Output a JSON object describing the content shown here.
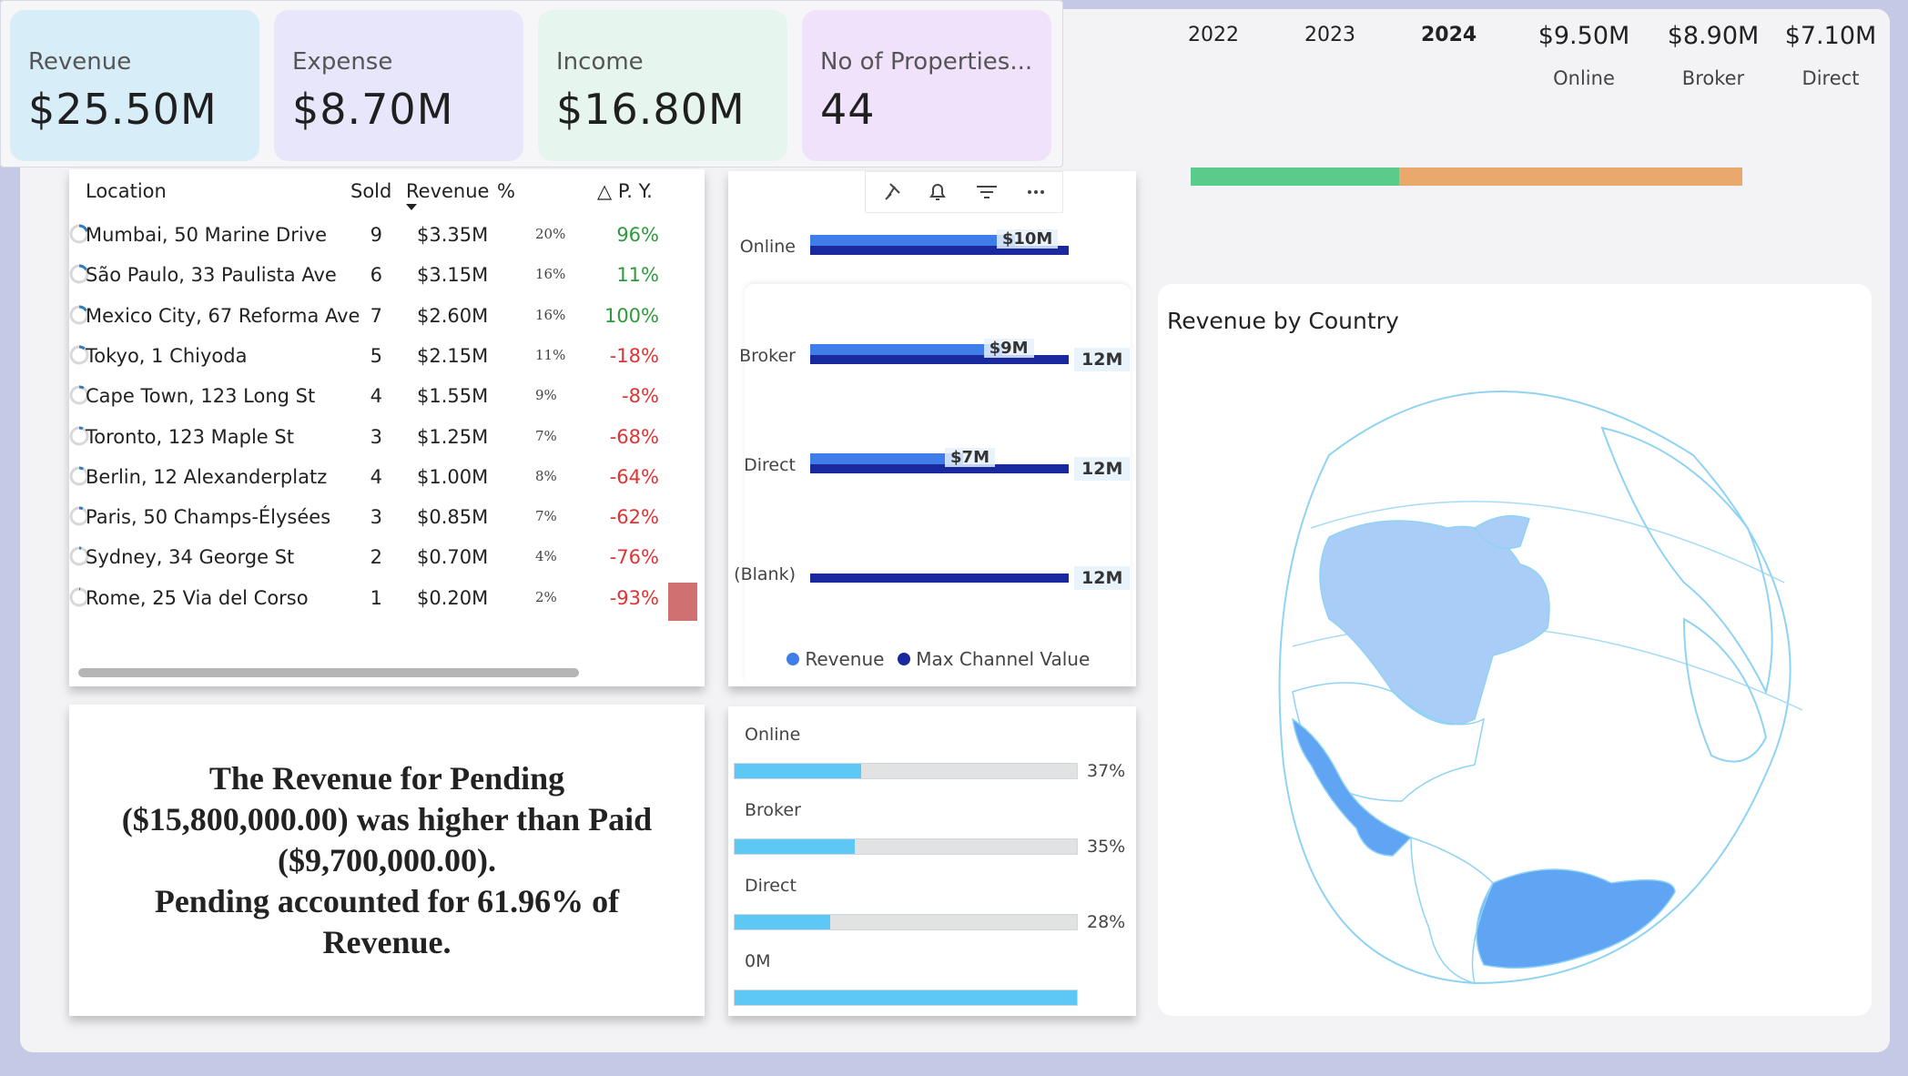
{
  "kpis": [
    {
      "label": "Revenue",
      "value": "$25.50M",
      "bg": "#d7edf7"
    },
    {
      "label": "Expense",
      "value": "$8.70M",
      "bg": "#e8e6fa"
    },
    {
      "label": "Income",
      "value": "$16.80M",
      "bg": "#e6f6ee"
    },
    {
      "label": "No of Properties...",
      "value": "44",
      "bg": "#f0e2fb"
    }
  ],
  "years": {
    "items": [
      "2022",
      "2023",
      "2024"
    ],
    "selected": "2024"
  },
  "channels": [
    {
      "value": "$9.50M",
      "label": "Online"
    },
    {
      "value": "$8.90M",
      "label": "Broker"
    },
    {
      "value": "$7.10M",
      "label": "Direct"
    }
  ],
  "progress_bar": {
    "segments": [
      {
        "share": 0.378,
        "color": "#5bcb8b"
      },
      {
        "share": 0.622,
        "color": "#e9a86c"
      }
    ]
  },
  "table": {
    "headers": {
      "location": "Location",
      "sold": "Sold",
      "revenue": "Revenue",
      "pct": "%",
      "py": "△ P. Y."
    },
    "rows": [
      {
        "location": "Mumbai, 50 Marine Drive",
        "sold": "9",
        "revenue": "$3.35M",
        "pct": "20%",
        "pct_value": 20,
        "py": "96%",
        "trend": "pos"
      },
      {
        "location": "São Paulo, 33 Paulista Ave",
        "sold": "6",
        "revenue": "$3.15M",
        "pct": "16%",
        "pct_value": 16,
        "py": "11%",
        "trend": "pos"
      },
      {
        "location": "Mexico City, 67 Reforma Ave",
        "sold": "7",
        "revenue": "$2.60M",
        "pct": "16%",
        "pct_value": 16,
        "py": "100%",
        "trend": "pos"
      },
      {
        "location": "Tokyo, 1 Chiyoda",
        "sold": "5",
        "revenue": "$2.15M",
        "pct": "11%",
        "pct_value": 11,
        "py": "-18%",
        "trend": "neg"
      },
      {
        "location": "Cape Town, 123 Long St",
        "sold": "4",
        "revenue": "$1.55M",
        "pct": "9%",
        "pct_value": 9,
        "py": "-8%",
        "trend": "neg"
      },
      {
        "location": "Toronto, 123 Maple St",
        "sold": "3",
        "revenue": "$1.25M",
        "pct": "7%",
        "pct_value": 7,
        "py": "-68%",
        "trend": "neg"
      },
      {
        "location": "Berlin, 12 Alexanderplatz",
        "sold": "4",
        "revenue": "$1.00M",
        "pct": "8%",
        "pct_value": 8,
        "py": "-64%",
        "trend": "neg"
      },
      {
        "location": "Paris, 50 Champs-Élysées",
        "sold": "3",
        "revenue": "$0.85M",
        "pct": "7%",
        "pct_value": 7,
        "py": "-62%",
        "trend": "neg"
      },
      {
        "location": "Sydney, 34 George St",
        "sold": "2",
        "revenue": "$0.70M",
        "pct": "4%",
        "pct_value": 4,
        "py": "-76%",
        "trend": "neg"
      },
      {
        "location": "Rome, 25 Via del Corso",
        "sold": "1",
        "revenue": "$0.20M",
        "pct": "2%",
        "pct_value": 2,
        "py": "-93%",
        "trend": "neg"
      }
    ]
  },
  "narrative": [
    "The Revenue for Pending",
    "($15,800,000.00) was higher than Paid",
    "($9,700,000.00).",
    "Pending accounted for 61.96% of",
    "Revenue."
  ],
  "channel_chart": {
    "toolbar": [
      "pin-icon",
      "bell-icon",
      "filter-icon",
      "more-icon"
    ],
    "legend": [
      {
        "name": "Revenue",
        "color": "#3f7ee8"
      },
      {
        "name": "Max Channel Value",
        "color": "#1a2a9e"
      }
    ],
    "rows": [
      {
        "label": "Online",
        "revenue_label": "$10M",
        "max_label": ""
      },
      {
        "label": "Broker",
        "revenue_label": "$9M",
        "max_label": "12M"
      },
      {
        "label": "Direct",
        "revenue_label": "$7M",
        "max_label": "12M"
      },
      {
        "label": "(Blank)",
        "revenue_label": "",
        "max_label": "12M"
      }
    ]
  },
  "chart_data": {
    "type": "bar",
    "categories": [
      "Online",
      "Broker",
      "Direct",
      "(Blank)"
    ],
    "series": [
      {
        "name": "Revenue",
        "values": [
          9.5,
          8.9,
          7.1,
          0
        ]
      },
      {
        "name": "Max Channel Value",
        "values": [
          12,
          12,
          12,
          12
        ]
      }
    ],
    "xlim": [
      0,
      12
    ]
  },
  "share_bars": [
    {
      "label": "Online",
      "pct": "37%",
      "value": 0.37
    },
    {
      "label": "Broker",
      "pct": "35%",
      "value": 0.35
    },
    {
      "label": "Direct",
      "pct": "28%",
      "value": 0.28
    },
    {
      "label": "0M",
      "pct": "",
      "value": 1.0
    }
  ],
  "map": {
    "title": "Revenue by Country"
  }
}
